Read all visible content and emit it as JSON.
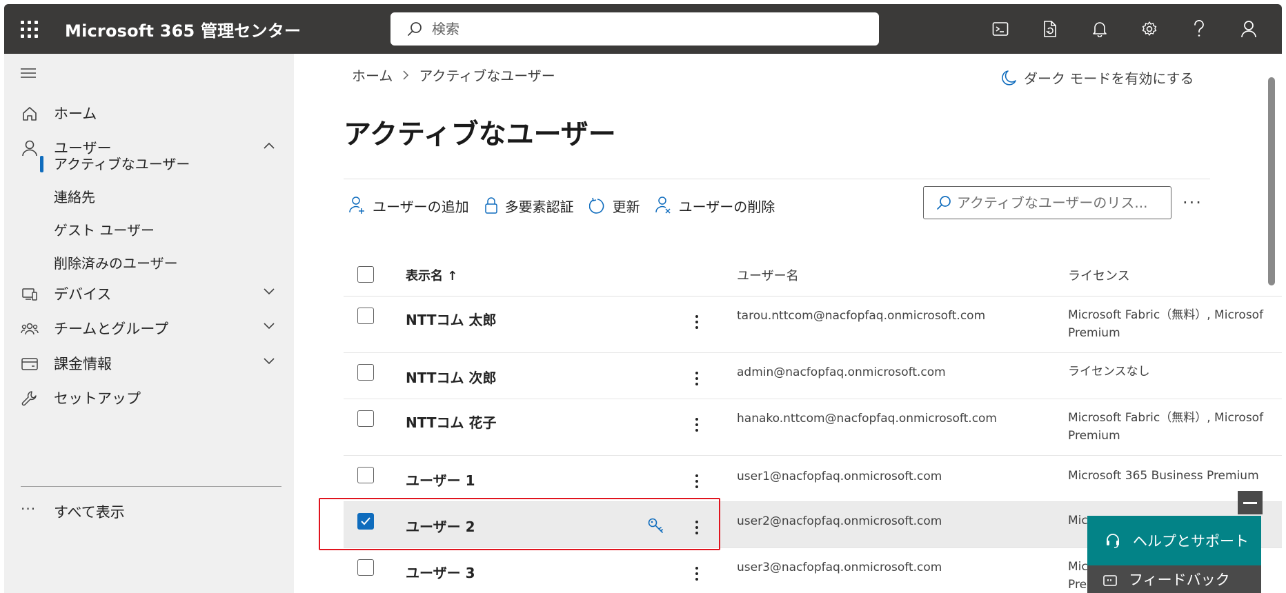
{
  "app": {
    "title": "Microsoft 365 管理センター"
  },
  "header": {
    "search_placeholder": "検索",
    "icons": [
      "terminal-icon",
      "document-sync-icon",
      "bell-icon",
      "gear-icon",
      "help-icon",
      "person-icon"
    ]
  },
  "sidebar": {
    "home": "ホーム",
    "users": "ユーザー",
    "users_sub": [
      "アクティブなユーザー",
      "連絡先",
      "ゲスト ユーザー",
      "削除済みのユーザー"
    ],
    "devices": "デバイス",
    "teams": "チームとグループ",
    "billing": "課金情報",
    "setup": "セットアップ",
    "show_all": "すべて表示"
  },
  "main": {
    "breadcrumb": [
      "ホーム",
      "アクティブなユーザー"
    ],
    "dark_mode": "ダーク モードを有効にする",
    "title": "アクティブなユーザー",
    "toolbar": {
      "add_user": "ユーザーの追加",
      "mfa": "多要素認証",
      "refresh": "更新",
      "delete_user": "ユーザーの削除",
      "search_placeholder": "アクティブなユーザーのリス..."
    },
    "table": {
      "headers": {
        "display_name": "表示名 ↑",
        "username": "ユーザー名",
        "license": "ライセンス"
      },
      "rows": [
        {
          "name": "NTTコム 太郎",
          "username": "tarou.nttcom@nacfopfaq.onmicrosoft.com",
          "license1": "Microsoft Fabric（無料）, Microsof",
          "license2": "Premium",
          "checked": false
        },
        {
          "name": "NTTコム 次郎",
          "username": "admin@nacfopfaq.onmicrosoft.com",
          "license1": "ライセンスなし",
          "license2": "",
          "checked": false
        },
        {
          "name": "NTTコム 花子",
          "username": "hanako.nttcom@nacfopfaq.onmicrosoft.com",
          "license1": "Microsoft Fabric（無料）, Microsof",
          "license2": "Premium",
          "checked": false
        },
        {
          "name": "ユーザー 1",
          "username": "user1@nacfopfaq.onmicrosoft.com",
          "license1": "Microsoft 365 Business Premium",
          "license2": "",
          "checked": false
        },
        {
          "name": "ユーザー 2",
          "username": "user2@nacfopfaq.onmicrosoft.com",
          "license1": "Mic",
          "license2": "",
          "checked": true
        },
        {
          "name": "ユーザー 3",
          "username": "user3@nacfopfaq.onmicrosoft.com",
          "license1": "Mic",
          "license2": "Pre",
          "checked": false
        }
      ]
    }
  },
  "help": {
    "help_support": "ヘルプとサポート",
    "feedback": "フィードバック"
  },
  "colors": {
    "topbar": "#3b3a39",
    "sidebar": "#f0f0f0",
    "accent": "#0f6cbd",
    "help": "#038387",
    "highlight": "#e0141e"
  }
}
